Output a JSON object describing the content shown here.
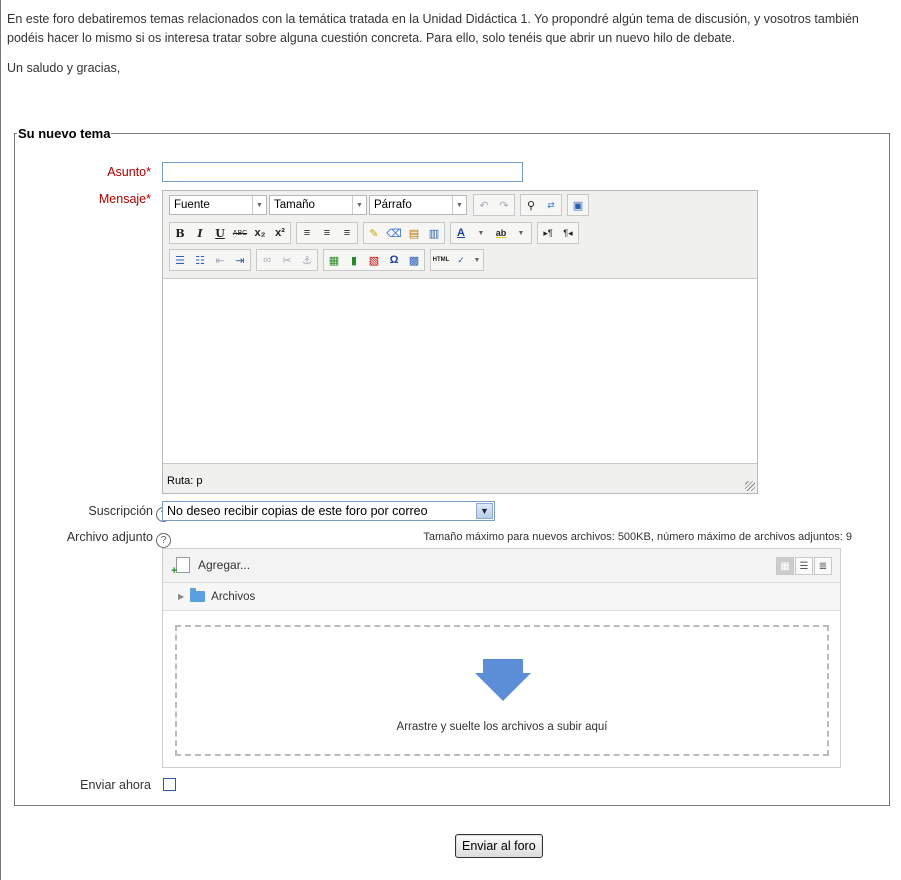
{
  "intro": {
    "paragraph1": "En este foro debatiremos temas relacionados con la temática tratada en la Unidad Didáctica 1. Yo propondré algún tema de discusión, y vosotros también podéis hacer lo mismo si os interesa tratar sobre alguna cuestión concreta. Para ello, solo tenéis que abrir un nuevo hilo de debate.",
    "paragraph2": "Un saludo y gracias,"
  },
  "form": {
    "legend": "Su nuevo tema",
    "subject_label": "Asunto",
    "subject_value": "",
    "message_label": "Mensaje",
    "required_mark": "*",
    "subscription_label": "Suscripción",
    "subscription_value": "No deseo recibir copias de este foro por correo",
    "attachment_label": "Archivo adjunto",
    "attachment_info": "Tamaño máximo para nuevos archivos: 500KB, número máximo de archivos adjuntos: 9",
    "send_now_label": "Enviar ahora",
    "help_glyph": "?",
    "submit_label": "Enviar al foro"
  },
  "editor": {
    "font_select": "Fuente",
    "size_select": "Tamaño",
    "format_select": "Párrafo",
    "path_label": "Ruta: p"
  },
  "filemanager": {
    "add_label": "Agregar...",
    "folder_label": "Archivos",
    "drop_text": "Arrastre y suelte los archivos a subir aquí"
  },
  "colors": {
    "required": "#aa0000",
    "drop_arrow": "#5b8ed6"
  }
}
